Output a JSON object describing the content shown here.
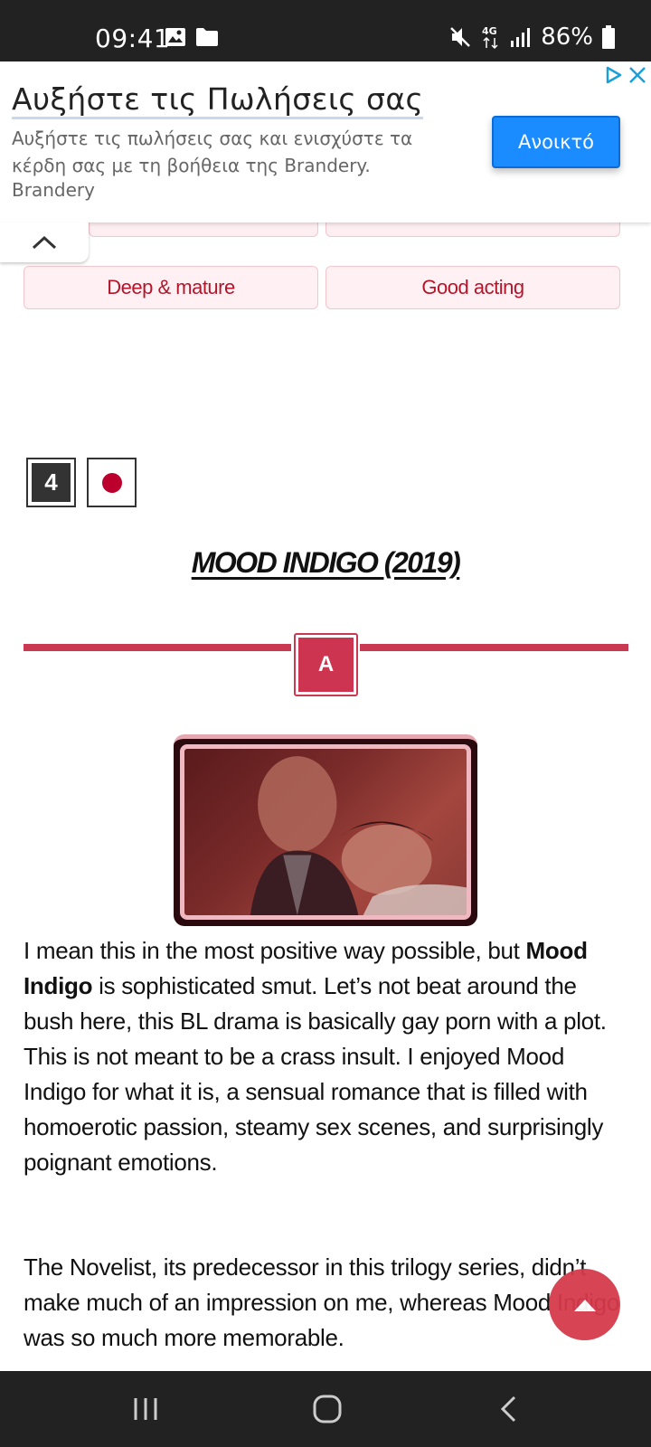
{
  "status_bar": {
    "time": "09:41",
    "battery": "86%",
    "network": "4G"
  },
  "ad": {
    "title": "Αυξήστε τις Πωλήσεις σας",
    "description": "Αυξήστε τις πωλήσεις σας και ενισχύστε τα κέρδη σας με τη βοήθεια της Brandery.",
    "source": "Brandery",
    "button_label": "Ανοικτό",
    "accent_color": "#1a8cff"
  },
  "tags": [
    "Deep & mature",
    "Good acting"
  ],
  "entry": {
    "rank": "4",
    "country_flag": "japan-flag",
    "title": "MOOD INDIGO (2019)",
    "grade": "A"
  },
  "article": {
    "paragraph1_part1": "I mean this in the most positive way possible, but ",
    "paragraph1_bold": "Mood Indigo",
    "paragraph1_part2": " is sophisticated smut. Let’s not beat around the bush here, this BL drama is basically gay porn with a plot. This is not meant to be a crass insult. I enjoyed Mood Indigo for what it is, a sensual romance that is filled with homoerotic passion, steamy sex scenes, and surprisingly poignant emotions.",
    "paragraph2": "The Novelist, its predecessor in this trilogy series, didn’t make much of an impression on me, whereas Mood Indigo was so much more memorable."
  },
  "colors": {
    "accent": "#c93a52",
    "tag_text": "#b5152b",
    "tag_bg": "#fff1f3"
  }
}
